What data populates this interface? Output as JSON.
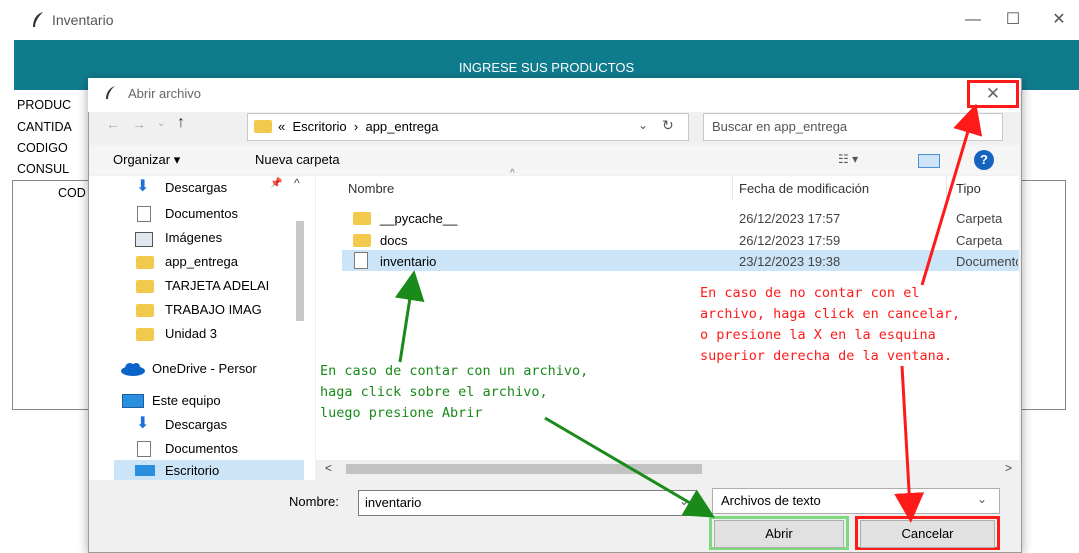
{
  "app": {
    "title": "Inventario",
    "header": "INGRESE SUS PRODUCTOS",
    "labels": [
      "PRODUC",
      "CANTIDA",
      "CODIGO",
      "CONSUL"
    ],
    "column_partial": "COD",
    "window_controls": {
      "minimize": "—",
      "maximize": "☐",
      "close": "✕"
    }
  },
  "dialog": {
    "title": "Abrir archivo",
    "close": "✕",
    "breadcrumb": {
      "prefix": "«",
      "part1": "Escritorio",
      "sep": "›",
      "part2": "app_entrega"
    },
    "search_placeholder": "Buscar en app_entrega",
    "toolbar": {
      "organize": "Organizar ▾",
      "new_folder": "Nueva carpeta"
    },
    "nav_items": [
      {
        "label": "Descargas",
        "icon": "download-icon"
      },
      {
        "label": "Documentos",
        "icon": "document-icon"
      },
      {
        "label": "Imágenes",
        "icon": "image-icon"
      },
      {
        "label": "app_entrega",
        "icon": "folder-icon"
      },
      {
        "label": "TARJETA ADELAI",
        "icon": "folder-icon"
      },
      {
        "label": "TRABAJO IMAG",
        "icon": "folder-icon"
      },
      {
        "label": "Unidad 3",
        "icon": "folder-icon"
      },
      {
        "label": "OneDrive - Persor",
        "icon": "cloud-icon"
      },
      {
        "label": "Este equipo",
        "icon": "computer-icon"
      },
      {
        "label": "Descargas",
        "icon": "download-icon"
      },
      {
        "label": "Documentos",
        "icon": "document-icon"
      },
      {
        "label": "Escritorio",
        "icon": "desktop-icon"
      }
    ],
    "columns": {
      "name": "Nombre",
      "date": "Fecha de modificación",
      "type": "Tipo"
    },
    "files": [
      {
        "name": "__pycache__",
        "date": "26/12/2023 17:57",
        "type": "Carpeta"
      },
      {
        "name": "docs",
        "date": "26/12/2023 17:59",
        "type": "Carpeta"
      },
      {
        "name": "inventario",
        "date": "23/12/2023 19:38",
        "type": "Documento"
      }
    ],
    "filename_label": "Nombre:",
    "filename_value": "inventario",
    "filter_value": "Archivos de texto",
    "open_button": "Abrir",
    "cancel_button": "Cancelar"
  },
  "annotations": {
    "green": [
      "En caso de contar con un archivo,",
      "haga click sobre el archivo,",
      "luego presione Abrir"
    ],
    "red": [
      "En caso de no contar con el",
      "archivo, haga click en cancelar,",
      "o presione la X en la esquina",
      "superior derecha de la ventana."
    ],
    "green_color": "#1a8a1a",
    "red_color": "#ff1a1a"
  }
}
